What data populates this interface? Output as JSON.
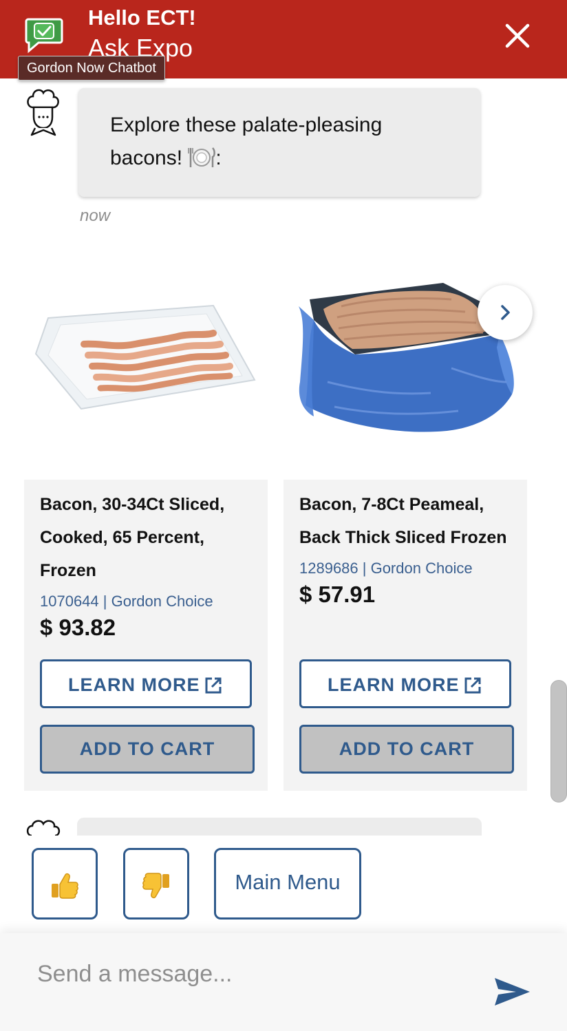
{
  "header": {
    "title": "Hello ECT!",
    "subtitle": "Ask Expo",
    "tooltip": "Gordon Now Chatbot",
    "brand_color": "#b9261c",
    "close_icon": "close-icon"
  },
  "message": {
    "text": "Explore these palate-pleasing bacons! ",
    "emoji": "plate-with-cutlery",
    "suffix": ":",
    "timestamp": "now",
    "avatar": "chef-icon"
  },
  "products": [
    {
      "name": "Bacon, 30-34Ct Sliced, Cooked, 65 Percent, Frozen",
      "meta": "1070644 | Gordon Choice",
      "price": "$ 93.82",
      "learn_more": "LEARN MORE",
      "add_to_cart": "ADD TO CART"
    },
    {
      "name": "Bacon, 7-8Ct Peameal, Back Thick Sliced Frozen",
      "meta": "1289686 | Gordon Choice",
      "price": "$ 57.91",
      "learn_more": "LEARN MORE",
      "add_to_cart": "ADD TO CART"
    }
  ],
  "quick_replies": {
    "thumbs_up": "👍",
    "thumbs_down": "👎",
    "main_menu": "Main Menu"
  },
  "composer": {
    "placeholder": "Send a message...",
    "send_icon": "send-icon"
  },
  "colors": {
    "accent": "#2f5a8c",
    "card_bg": "#f3f3f3",
    "bubble_bg": "#ececec"
  }
}
